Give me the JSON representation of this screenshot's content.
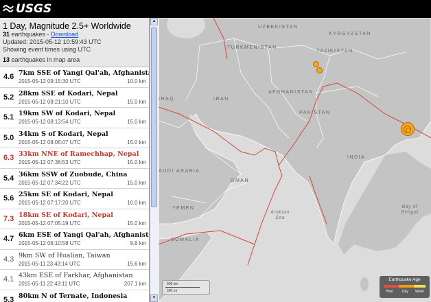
{
  "header": {
    "logo_text": "USGS"
  },
  "summary": {
    "title": "1 Day, Magnitude 2.5+ Worldwide",
    "count": "31",
    "count_suffix": " earthquakes - ",
    "download": "Download",
    "updated": "Updated: 2015-05-12 10:59:43 UTC",
    "timezone_note": "Showing event times using UTC",
    "map_count": "13",
    "map_count_suffix": " earthquakes in map area"
  },
  "earthquakes": [
    {
      "mag": "4.6",
      "place": "7km SSE of Yangi Qal'ah, Afghanistan",
      "time": "2015-05-12 09:15:30 UTC",
      "depth": "10.0 km",
      "highlight": false,
      "light": false
    },
    {
      "mag": "5.2",
      "place": "28km SSE of Kodari, Nepal",
      "time": "2015-05-12 08:21:10 UTC",
      "depth": "15.0 km",
      "highlight": false,
      "light": false
    },
    {
      "mag": "5.1",
      "place": "19km SW of Kodari, Nepal",
      "time": "2015-05-12 08:13:54 UTC",
      "depth": "15.0 km",
      "highlight": false,
      "light": false
    },
    {
      "mag": "5.0",
      "place": "34km S of Kodari, Nepal",
      "time": "2015-05-12 08:06:07 UTC",
      "depth": "15.0 km",
      "highlight": false,
      "light": false
    },
    {
      "mag": "6.3",
      "place": "33km NNE of Ramechhap, Nepal",
      "time": "2015-05-12 07:36:53 UTC",
      "depth": "15.0 km",
      "highlight": true,
      "light": false
    },
    {
      "mag": "5.4",
      "place": "36km SSW of Zuobude, China",
      "time": "2015-05-12 07:34:22 UTC",
      "depth": "15.0 km",
      "highlight": false,
      "light": false
    },
    {
      "mag": "5.6",
      "place": "25km SE of Kodari, Nepal",
      "time": "2015-05-12 07:17:20 UTC",
      "depth": "10.0 km",
      "highlight": false,
      "light": false
    },
    {
      "mag": "7.3",
      "place": "18km SE of Kodari, Nepal",
      "time": "2015-05-12 07:05:19 UTC",
      "depth": "15.0 km",
      "highlight": true,
      "light": false
    },
    {
      "mag": "4.7",
      "place": "6km ESE of Yangi Qal'ah, Afghanistan",
      "time": "2015-05-12 06:10:58 UTC",
      "depth": "9.8 km",
      "highlight": false,
      "light": false
    },
    {
      "mag": "4.3",
      "place": "9km SW of Hualian, Taiwan",
      "time": "2015-05-11 23:43:14 UTC",
      "depth": "15.6 km",
      "highlight": false,
      "light": true
    },
    {
      "mag": "4.1",
      "place": "43km ESE of Farkhar, Afghanistan",
      "time": "2015-05-11 22:43:11 UTC",
      "depth": "207.1 km",
      "highlight": false,
      "light": true
    },
    {
      "mag": "5.3",
      "place": "80km N of Ternate, Indonesia",
      "time": "",
      "depth": "",
      "highlight": false,
      "light": false
    }
  ],
  "map": {
    "labels": {
      "uzbekistan": "UZBEKISTAN",
      "kyrgyzstan": "KYRGYZSTAN",
      "turkmenistan": "TURKMENISTAN",
      "tajikistan": "TAJIKISTAN",
      "afghanistan": "AFGHANISTAN",
      "iran": "IRAN",
      "iraq": "IRAQ",
      "pakistan": "PAKISTAN",
      "india": "INDIA",
      "saudi_arabia": "AUDI ARABIA",
      "oman": "OMAN",
      "yemen": "YEMEN",
      "somalia": "SOMALIA",
      "arabian_sea": "Arabian Sea",
      "bay_of_bengal": "Bay of Bengal"
    },
    "scale": {
      "km": "500 km",
      "mi": "500 mi"
    },
    "legend": {
      "title": "Earthquake Age",
      "hour": "Hour",
      "day": "Day",
      "week": "Week"
    },
    "colors": {
      "land": "#c4c4c4",
      "sea": "#dcdcdc",
      "plate": "#d2463a",
      "quake": "#f5a623",
      "quake_stroke": "#b36b00"
    }
  }
}
